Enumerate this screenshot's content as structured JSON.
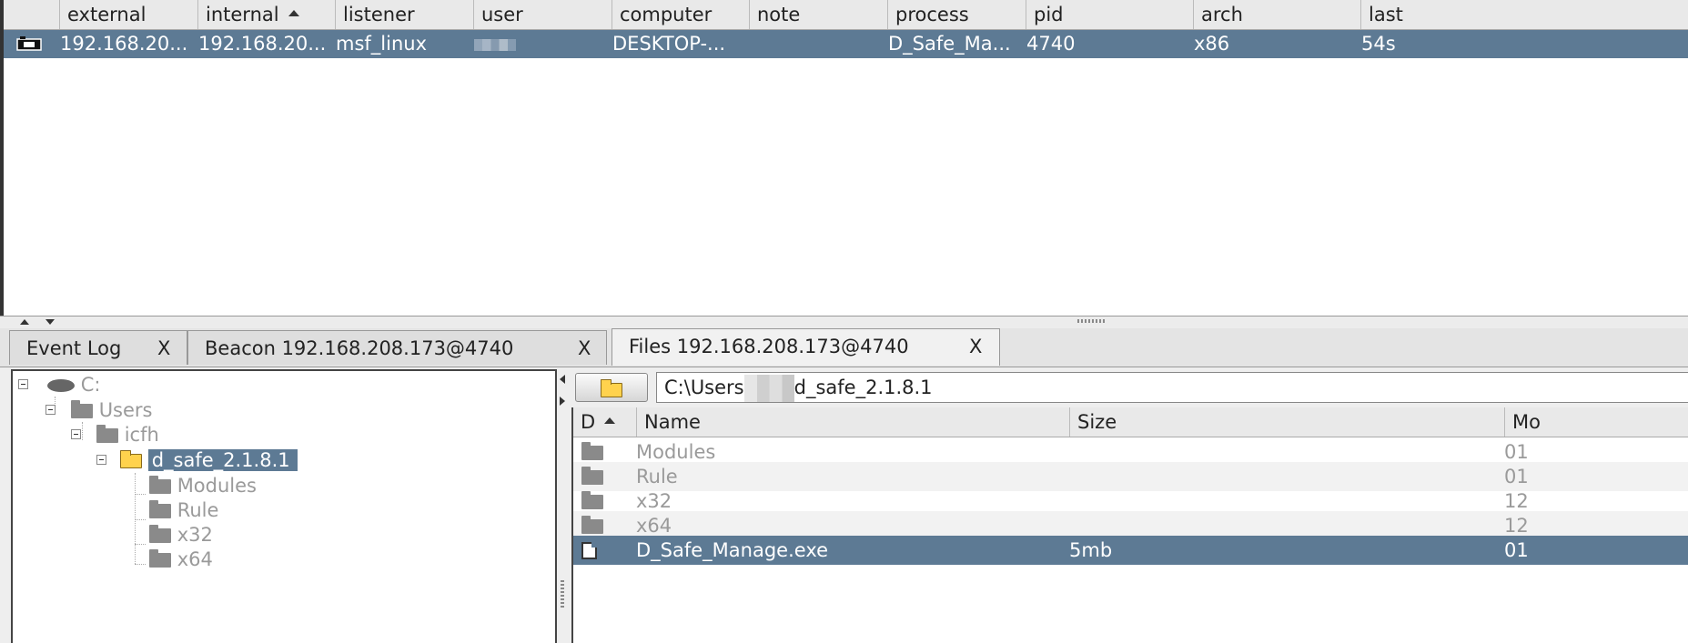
{
  "beacons": {
    "columns": [
      "external",
      "internal",
      "listener",
      "user",
      "computer",
      "note",
      "process",
      "pid",
      "arch",
      "last"
    ],
    "rows": [
      {
        "external": "192.168.20...",
        "internal": "192.168.20...",
        "listener": "msf_linux",
        "user": "",
        "computer": "DESKTOP-...",
        "note": "",
        "process": "D_Safe_Ma...",
        "pid": "4740",
        "arch": "x86",
        "last": "54s"
      }
    ]
  },
  "tabs": [
    {
      "label": "Event Log",
      "close": "X"
    },
    {
      "label": "Beacon 192.168.208.173@4740",
      "close": "X"
    },
    {
      "label": "Files 192.168.208.173@4740",
      "close": "X"
    }
  ],
  "tree": {
    "drive": "C:",
    "users": "Users",
    "icfh": "icfh",
    "selected": "d_safe_2.1.8.1",
    "children": [
      "Modules",
      "Rule",
      "x32",
      "x64"
    ]
  },
  "path": {
    "before": "C:\\Users",
    "after": "d_safe_2.1.8.1"
  },
  "files": {
    "columns": {
      "d": "D",
      "name": "Name",
      "size": "Size",
      "modified": "Mo"
    },
    "rows": [
      {
        "name": "Modules",
        "size": "",
        "modified": "01"
      },
      {
        "name": "Rule",
        "size": "",
        "modified": "01"
      },
      {
        "name": "x32",
        "size": "",
        "modified": "12"
      },
      {
        "name": "x64",
        "size": "",
        "modified": "12"
      },
      {
        "name": "D_Safe_Manage.exe",
        "size": "5mb",
        "modified": "01"
      }
    ]
  },
  "colors": {
    "selection": "#5d7a94",
    "folder_open": "#ffd24d"
  }
}
